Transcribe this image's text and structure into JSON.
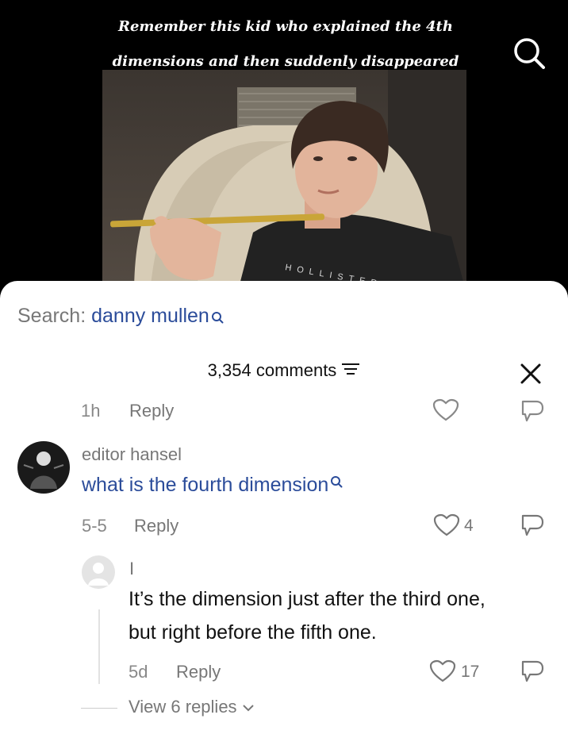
{
  "video": {
    "caption_line1": "Remember this kid who explained the 4th",
    "caption_line2": "dimensions and then suddenly disappeared",
    "shirt_text": "HOLLISTER"
  },
  "search_suggestion": {
    "prefix": "Search:",
    "term": "danny mullen"
  },
  "comments_header": {
    "count_label": "3,354 comments"
  },
  "prev_comment": {
    "time": "1h",
    "reply_label": "Reply"
  },
  "comment": {
    "username": "editor hansel",
    "text": "what is the fourth dimension",
    "date": "5-5",
    "reply_label": "Reply",
    "likes": "4"
  },
  "reply_comment": {
    "username": "I",
    "text_line1": "It’s the dimension just after the third one,",
    "text_line2": "but right before the fifth one.",
    "date": "5d",
    "reply_label": "Reply",
    "likes": "17"
  },
  "view_replies_label": "View 6 replies",
  "colors": {
    "link_blue": "#2b4c9a",
    "muted_text": "#777777",
    "sheet_bg": "#ffffff",
    "video_bg": "#000000"
  },
  "icons": [
    "search-icon",
    "filter-icon",
    "close-icon",
    "heart-icon",
    "dislike-icon",
    "chevron-down-icon"
  ]
}
